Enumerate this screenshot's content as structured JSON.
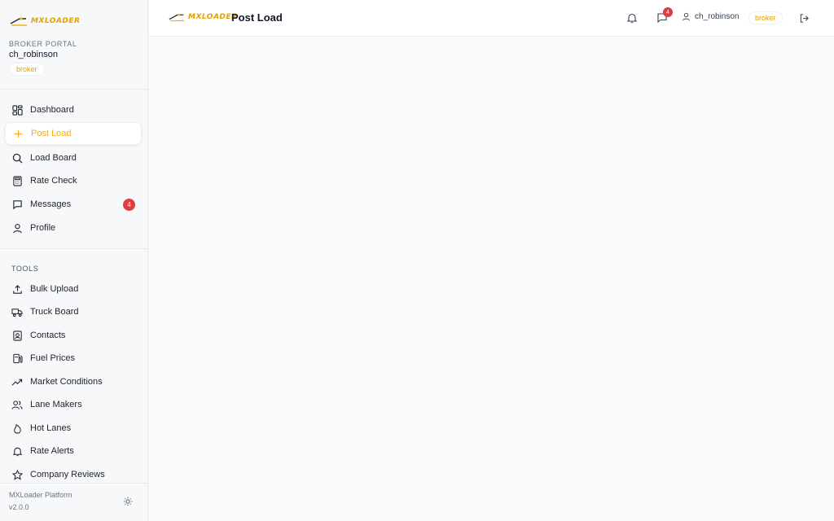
{
  "brand": {
    "logo_text": "MXLOADER",
    "accent": "#f0b020"
  },
  "sidebar": {
    "portal_label": "BROKER PORTAL",
    "username": "ch_robinson",
    "role": "broker",
    "main_items": [
      {
        "label": "Dashboard",
        "icon": "dashboard-icon"
      },
      {
        "label": "Post Load",
        "icon": "plus-icon",
        "active": true
      },
      {
        "label": "Load Board",
        "icon": "search-icon"
      },
      {
        "label": "Rate Check",
        "icon": "calculator-icon"
      },
      {
        "label": "Messages",
        "icon": "message-icon",
        "badge": "4"
      },
      {
        "label": "Profile",
        "icon": "user-icon"
      }
    ],
    "tools_label": "TOOLS",
    "tool_items": [
      {
        "label": "Bulk Upload",
        "icon": "upload-icon"
      },
      {
        "label": "Truck Board",
        "icon": "truck-icon"
      },
      {
        "label": "Contacts",
        "icon": "contacts-icon"
      },
      {
        "label": "Fuel Prices",
        "icon": "fuel-icon"
      },
      {
        "label": "Market Conditions",
        "icon": "trending-up-icon"
      },
      {
        "label": "Lane Makers",
        "icon": "users-icon"
      },
      {
        "label": "Hot Lanes",
        "icon": "flame-icon"
      },
      {
        "label": "Rate Alerts",
        "icon": "bell-icon"
      },
      {
        "label": "Company Reviews",
        "icon": "star-icon"
      }
    ],
    "footer": {
      "platform": "MXLoader Platform",
      "version": "v2.0.0"
    }
  },
  "topbar": {
    "title": "Post Load",
    "messages_badge": "4",
    "username": "ch_robinson",
    "role": "broker"
  }
}
